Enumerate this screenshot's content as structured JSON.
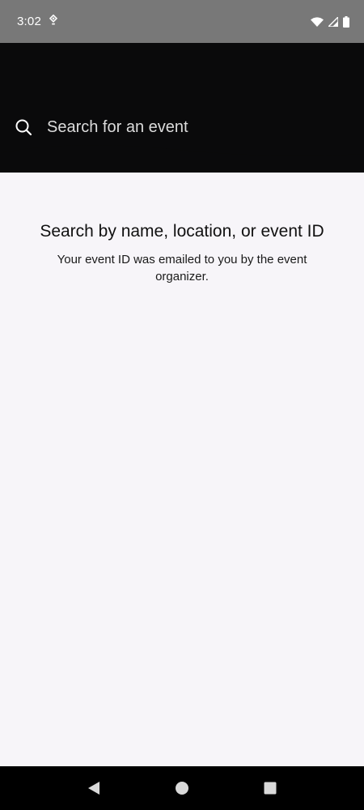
{
  "status_bar": {
    "time": "3:02",
    "icons": [
      "location-icon",
      "wifi-icon",
      "signal-icon",
      "battery-icon"
    ]
  },
  "search": {
    "placeholder": "Search for an event",
    "value": ""
  },
  "empty_state": {
    "title": "Search by name, location, or event ID",
    "subtitle": "Your event ID was emailed to you by the event organizer."
  },
  "nav_bar": {
    "icons": [
      "back-icon",
      "home-icon",
      "recents-icon"
    ]
  },
  "colors": {
    "header_bg": "#0a0a0b",
    "page_bg": "#f7f5f9",
    "status_bar_bg": "#787878"
  }
}
